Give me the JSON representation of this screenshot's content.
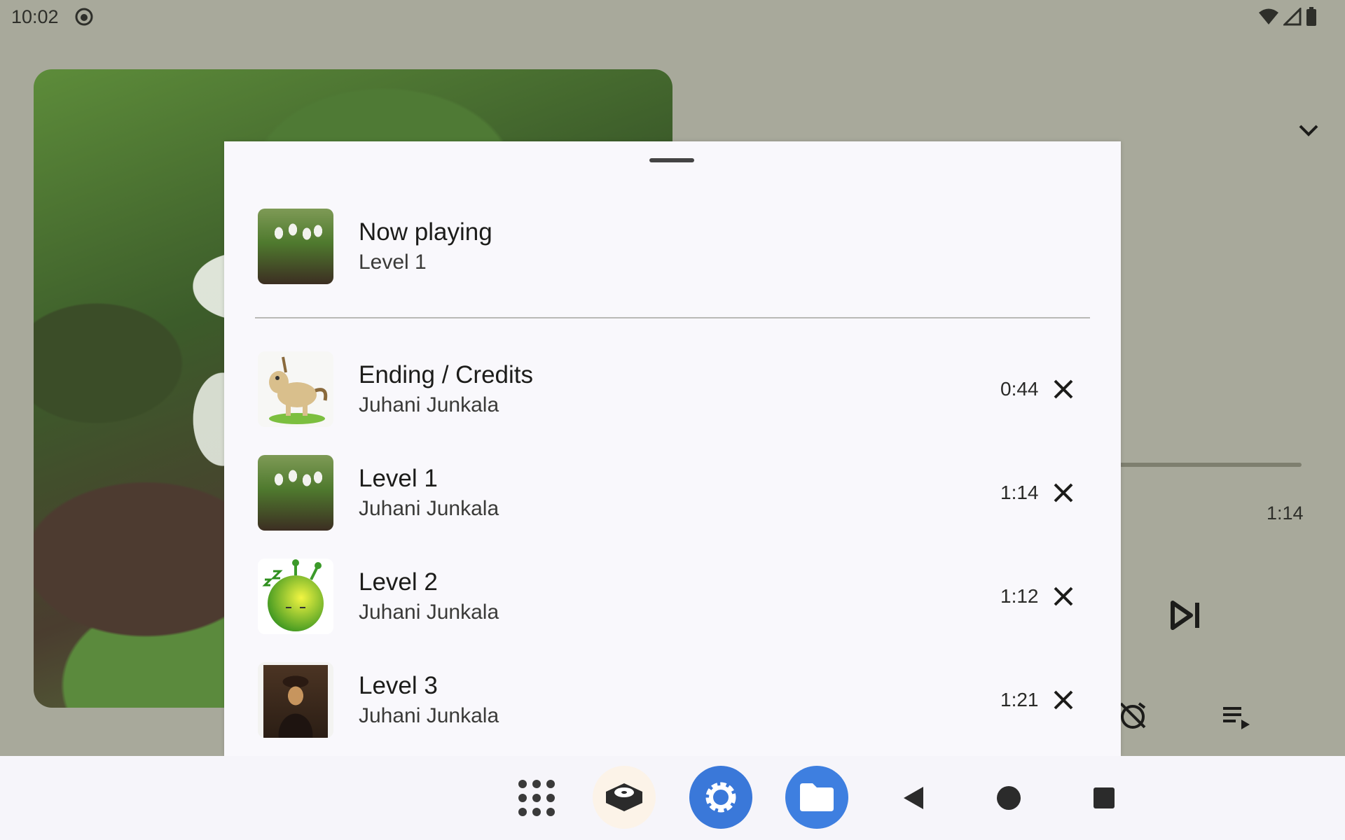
{
  "status_bar": {
    "time": "10:02",
    "icons": [
      "face-icon",
      "wifi-icon",
      "signal-icon",
      "battery-icon"
    ]
  },
  "player": {
    "total_time": "1:14",
    "controls": [
      "collapse-icon",
      "skip-next-icon",
      "sleep-timer-off-icon",
      "queue-icon"
    ]
  },
  "queue_sheet": {
    "now_playing": {
      "title": "Now playing",
      "track": "Level 1"
    },
    "items": [
      {
        "title": "Ending / Credits",
        "artist": "Juhani Junkala",
        "duration": "0:44",
        "thumb": "horse"
      },
      {
        "title": "Level 1",
        "artist": "Juhani Junkala",
        "duration": "1:14",
        "thumb": "snowdrop"
      },
      {
        "title": "Level 2",
        "artist": "Juhani Junkala",
        "duration": "1:12",
        "thumb": "alien"
      },
      {
        "title": "Level 3",
        "artist": "Juhani Junkala",
        "duration": "1:21",
        "thumb": "portrait"
      }
    ]
  },
  "nav_bar": {
    "items": [
      "app-launcher-icon",
      "music-app-icon",
      "settings-app-icon",
      "files-app-icon",
      "back-icon",
      "home-icon",
      "recents-icon"
    ]
  },
  "colors": {
    "scrim": "#a8a99b",
    "sheet": "#f9f8fc",
    "accent_blue": "#3a78d9"
  }
}
